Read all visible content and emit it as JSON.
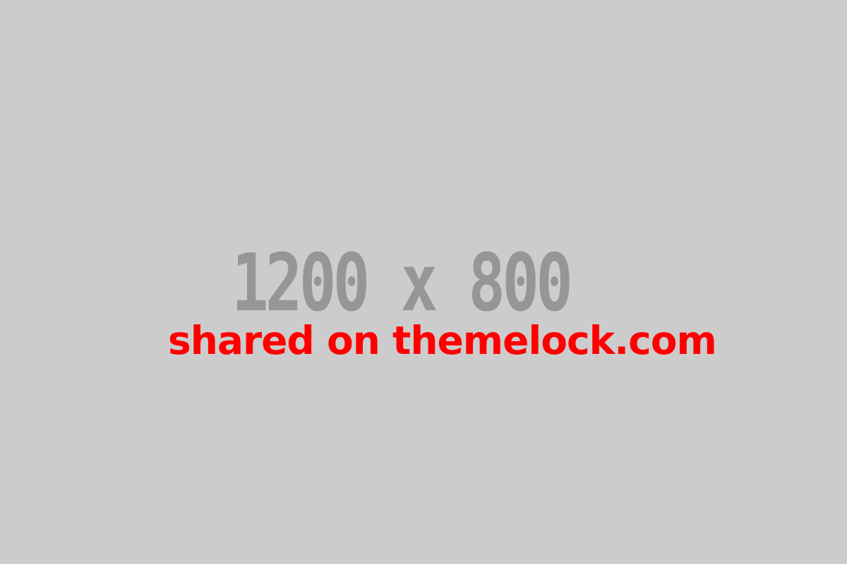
{
  "placeholder": {
    "dimensions_text": "1200 x 800",
    "watermark_text": "shared on themelock.com"
  },
  "colors": {
    "background": "#cccccc",
    "dimensions_text": "#969696",
    "watermark_text": "#ff0000"
  }
}
